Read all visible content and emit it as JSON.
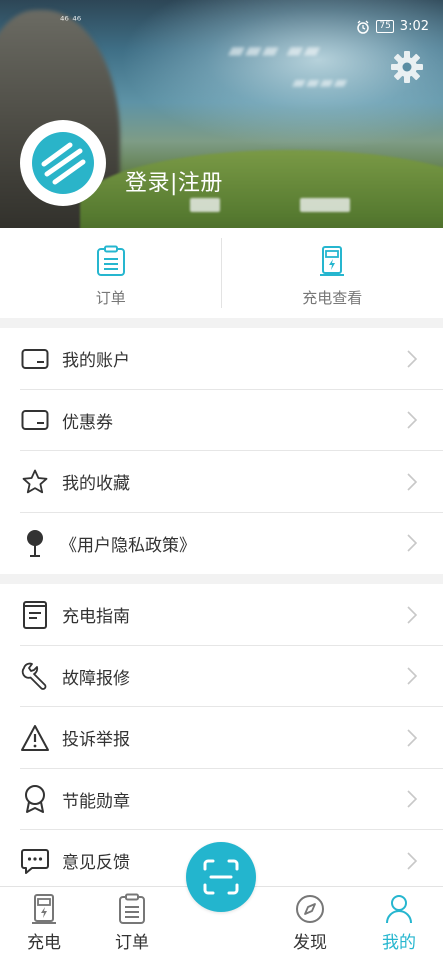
{
  "status_bar": {
    "left_text": "⁴⁶ ⁴⁶",
    "battery": "75",
    "time": "3:02"
  },
  "header": {
    "login_label": "登录|注册"
  },
  "quick_actions": [
    {
      "label": "订单",
      "icon": "order-clipboard-icon"
    },
    {
      "label": "充电查看",
      "icon": "charger-station-icon"
    }
  ],
  "menu_group_1": [
    {
      "label": "我的账户",
      "icon": "wallet-icon"
    },
    {
      "label": "优惠券",
      "icon": "coupon-icon"
    },
    {
      "label": "我的收藏",
      "icon": "star-icon"
    },
    {
      "label": "《用户隐私政策》",
      "icon": "pin-icon"
    }
  ],
  "menu_group_2": [
    {
      "label": "充电指南",
      "icon": "guide-book-icon"
    },
    {
      "label": "故障报修",
      "icon": "wrench-icon"
    },
    {
      "label": "投诉举报",
      "icon": "warning-icon"
    },
    {
      "label": "节能勋章",
      "icon": "medal-icon"
    },
    {
      "label": "意见反馈",
      "icon": "chat-bubble-icon"
    }
  ],
  "bottom_nav": [
    {
      "label": "充电",
      "icon": "charger-station-icon"
    },
    {
      "label": "订单",
      "icon": "order-clipboard-icon"
    },
    {
      "label": "发现",
      "icon": "compass-icon"
    },
    {
      "label": "我的",
      "icon": "user-icon",
      "active": true
    }
  ],
  "colors": {
    "accent": "#26b6cf",
    "scan_button": "#23b5ce"
  }
}
